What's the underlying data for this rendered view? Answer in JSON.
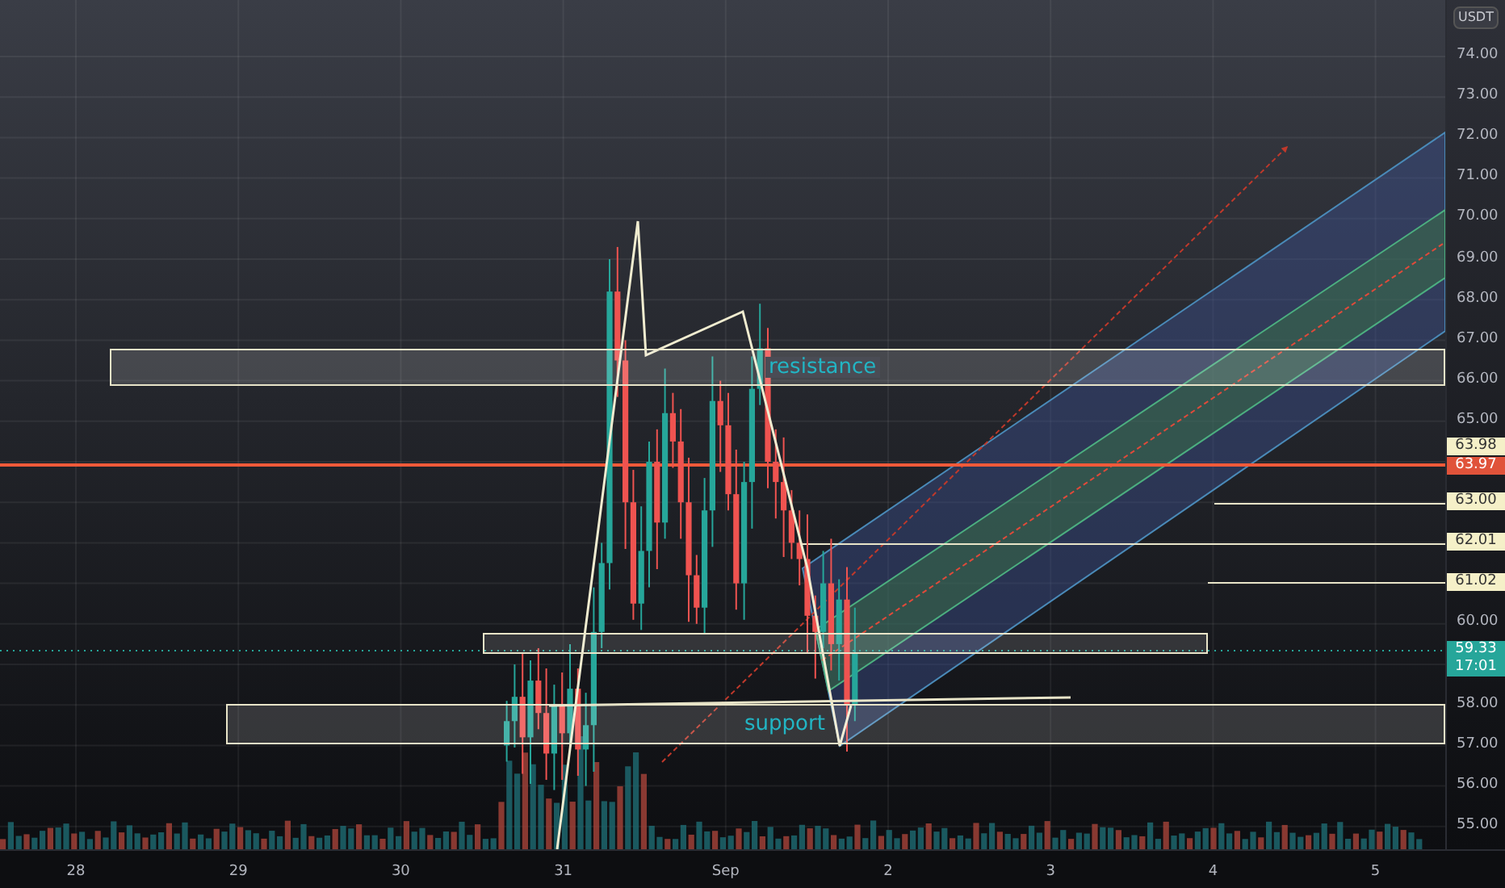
{
  "currency": "USDT",
  "price_ticks": [
    "74.00",
    "73.00",
    "72.00",
    "71.00",
    "70.00",
    "69.00",
    "68.00",
    "67.00",
    "66.00",
    "65.00",
    "60.00",
    "58.00",
    "57.00",
    "56.00",
    "55.00"
  ],
  "price_badges": [
    {
      "kind": "level",
      "text": "63.98"
    },
    {
      "kind": "alert",
      "text": "63.97"
    },
    {
      "kind": "level",
      "text": "63.00"
    },
    {
      "kind": "level",
      "text": "62.01"
    },
    {
      "kind": "level",
      "text": "61.02"
    },
    {
      "kind": "last",
      "text": "59.33",
      "countdown": "17:01"
    }
  ],
  "time_labels": [
    "28",
    "29",
    "30",
    "31",
    "Sep",
    "2",
    "3",
    "4",
    "5"
  ],
  "zones": [
    {
      "kind": "resistance",
      "label": "resistance"
    },
    {
      "kind": "support",
      "label": "support"
    }
  ]
}
